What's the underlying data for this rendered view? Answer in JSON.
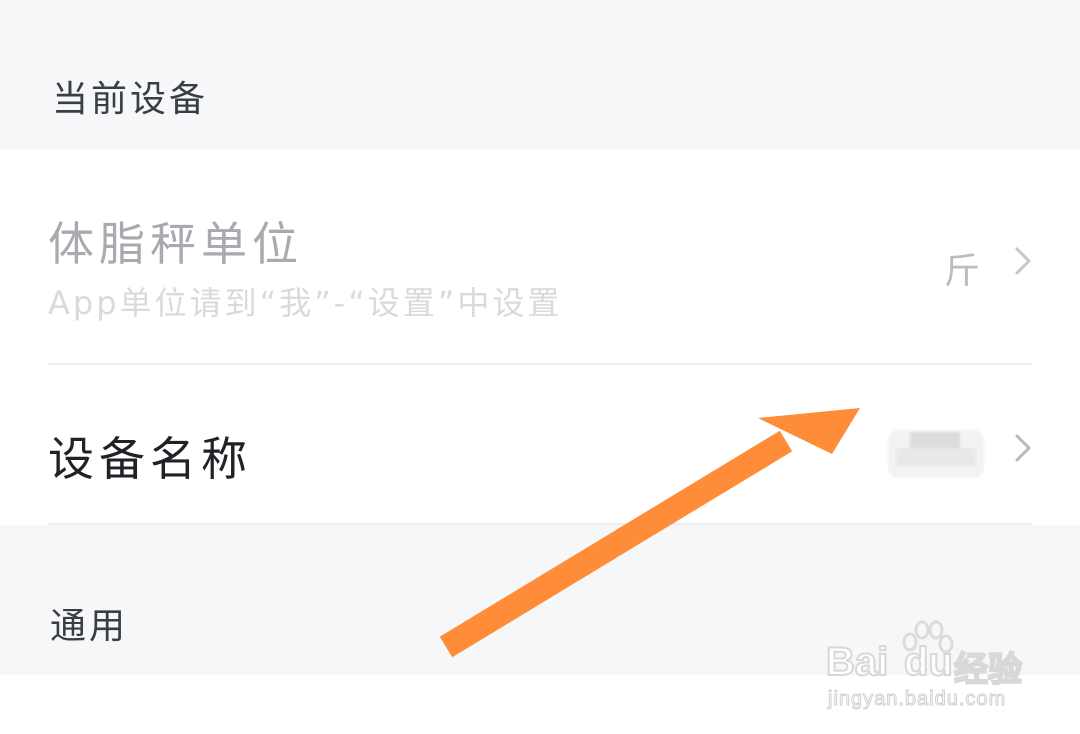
{
  "sections": {
    "current_device": {
      "title": "当前设备"
    },
    "general": {
      "title": "通用"
    }
  },
  "rows": {
    "scale_unit": {
      "title": "体脂秤单位",
      "subtitle": "App单位请到“我”-“设置”中设置",
      "value": "斤"
    },
    "device_name": {
      "title": "设备名称"
    }
  },
  "watermark": {
    "brand": "Bai",
    "brand_paw": "du",
    "brand_cn": "经验",
    "url": "jingyan.baidu.com"
  },
  "colors": {
    "header_bg": "#f6f7f9",
    "arrow": "#ff8c38",
    "disabled_text": "#b9bcc0"
  },
  "icons": {
    "chevron": "chevron-right-icon",
    "annotation": "orange-arrow-annotation"
  }
}
